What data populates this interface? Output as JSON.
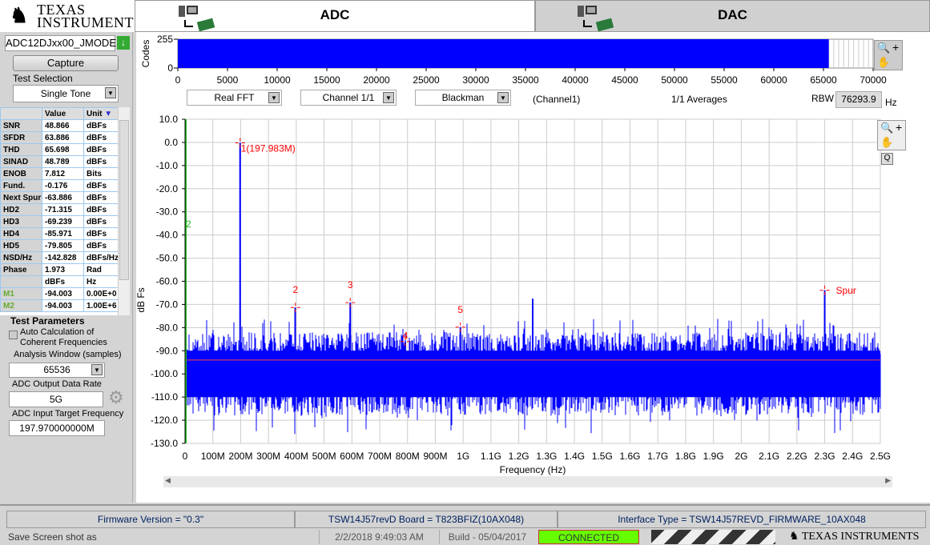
{
  "brand": {
    "line1": "Texas",
    "line2": "Instruments"
  },
  "tabs": [
    {
      "label": "ADC",
      "active": true
    },
    {
      "label": "DAC",
      "active": false
    }
  ],
  "left": {
    "device": "ADC12DJxx00_JMODE",
    "capture_label": "Capture",
    "test_selection_label": "Test Selection",
    "test_selection_value": "Single Tone",
    "results": {
      "headers": [
        "",
        "Value",
        "Unit"
      ],
      "rows": [
        [
          "SNR",
          "48.866",
          "dBFs"
        ],
        [
          "SFDR",
          "63.886",
          "dBFs"
        ],
        [
          "THD",
          "65.698",
          "dBFs"
        ],
        [
          "SINAD",
          "48.789",
          "dBFs"
        ],
        [
          "ENOB",
          "7.812",
          "Bits"
        ],
        [
          "Fund.",
          "-0.176",
          "dBFs"
        ],
        [
          "Next Spur",
          "-63.886",
          "dBFs"
        ],
        [
          "HD2",
          "-71.315",
          "dBFs"
        ],
        [
          "HD3",
          "-69.239",
          "dBFs"
        ],
        [
          "HD4",
          "-85.971",
          "dBFs"
        ],
        [
          "HD5",
          "-79.805",
          "dBFs"
        ],
        [
          "NSD/Hz",
          "-142.828",
          "dBFs/Hz"
        ],
        [
          "Phase",
          "1.973",
          "Rad"
        ],
        [
          "",
          "dBFs",
          "Hz"
        ],
        [
          "M1",
          "-94.003",
          "0.00E+0"
        ],
        [
          "M2",
          "-94.003",
          "1.00E+6"
        ]
      ]
    },
    "test_params_title": "Test Parameters",
    "auto_calc_label1": "Auto Calculation of",
    "auto_calc_label2": "Coherent Frequencies",
    "auto_calc_checked": false,
    "analysis_window_label": "Analysis Window (samples)",
    "analysis_window_value": "65536",
    "data_rate_label": "ADC Output Data Rate",
    "data_rate_value": "5G",
    "target_freq_label": "ADC Input Target Frequency",
    "target_freq_value": "197.970000000M"
  },
  "codes_plot": {
    "ylabel": "Codes",
    "yticks": [
      "255",
      "0"
    ],
    "xticks": [
      "0",
      "5000",
      "10000",
      "15000",
      "20000",
      "25000",
      "30000",
      "35000",
      "40000",
      "45000",
      "50000",
      "55000",
      "60000",
      "65000",
      "70000"
    ],
    "samples": 65536,
    "xmax": 70000,
    "color": "#0000ff"
  },
  "controls": {
    "fft_type": "Real FFT",
    "channel": "Channel 1/1",
    "window": "Blackman",
    "channel_label": "(Channel1)",
    "averages": "1/1 Averages",
    "rbw_label": "RBW",
    "rbw_value": "76293.9",
    "rbw_unit": "Hz"
  },
  "spectrum": {
    "ylabel": "dB Fs",
    "xlabel": "Frequency (Hz)",
    "yticks": [
      "10.0",
      "0.0",
      "-10.0",
      "-20.0",
      "-30.0",
      "-40.0",
      "-50.0",
      "-60.0",
      "-70.0",
      "-80.0",
      "-90.0",
      "-100.0",
      "-110.0",
      "-120.0",
      "-130.0"
    ],
    "xticks": [
      "0",
      "100M",
      "200M",
      "300M",
      "400M",
      "500M",
      "600M",
      "700M",
      "800M",
      "900M",
      "1G",
      "1.1G",
      "1.2G",
      "1.3G",
      "1.4G",
      "1.5G",
      "1.6G",
      "1.7G",
      "1.8G",
      "1.9G",
      "2G",
      "2.1G",
      "2.2G",
      "2.3G",
      "2.4G",
      "2.5G"
    ],
    "xrange_hz": [
      0,
      2500000000
    ],
    "yrange_db": [
      -130,
      10
    ],
    "noise_floor_db": -94.0,
    "tones": [
      {
        "f_mhz": 197.983,
        "db": -0.176
      },
      {
        "f_mhz": 396,
        "db": -71.3
      },
      {
        "f_mhz": 594,
        "db": -69.2
      },
      {
        "f_mhz": 792,
        "db": -86.0
      },
      {
        "f_mhz": 990,
        "db": -79.8
      },
      {
        "f_mhz": 1250,
        "db": -67.5
      },
      {
        "f_mhz": 2300,
        "db": -63.9
      }
    ],
    "markers": [
      {
        "label": "1(197.983M)",
        "f_mhz": 197.983,
        "db": -0.2
      },
      {
        "label": "2",
        "f_mhz": 397,
        "db": -71.3
      },
      {
        "label": "3",
        "f_mhz": 594,
        "db": -69.2
      },
      {
        "label": "4",
        "f_mhz": 792,
        "db": -86.0
      },
      {
        "label": "5",
        "f_mhz": 990,
        "db": -79.8
      },
      {
        "label": "Spur",
        "f_mhz": 2300,
        "db": -63.9
      }
    ],
    "cursor_label": "2",
    "trace_color": "#0000ff",
    "marker_color": "#ff0000",
    "floor_color": "#ff4040",
    "cursor_color": "#22bb22"
  },
  "statusbar": {
    "firmware": "Firmware Version = \"0.3\"",
    "board": "TSW14J57revD Board = T823BFIZ(10AX048)",
    "interface": "Interface Type = TSW14J57REVD_FIRMWARE_10AX048"
  },
  "bottom": {
    "save": "Save Screen shot as",
    "datetime": "2/2/2018 9:49:03 AM",
    "build": "Build  - 05/04/2017",
    "connection": "CONNECTED",
    "brand": "Texas Instruments"
  }
}
